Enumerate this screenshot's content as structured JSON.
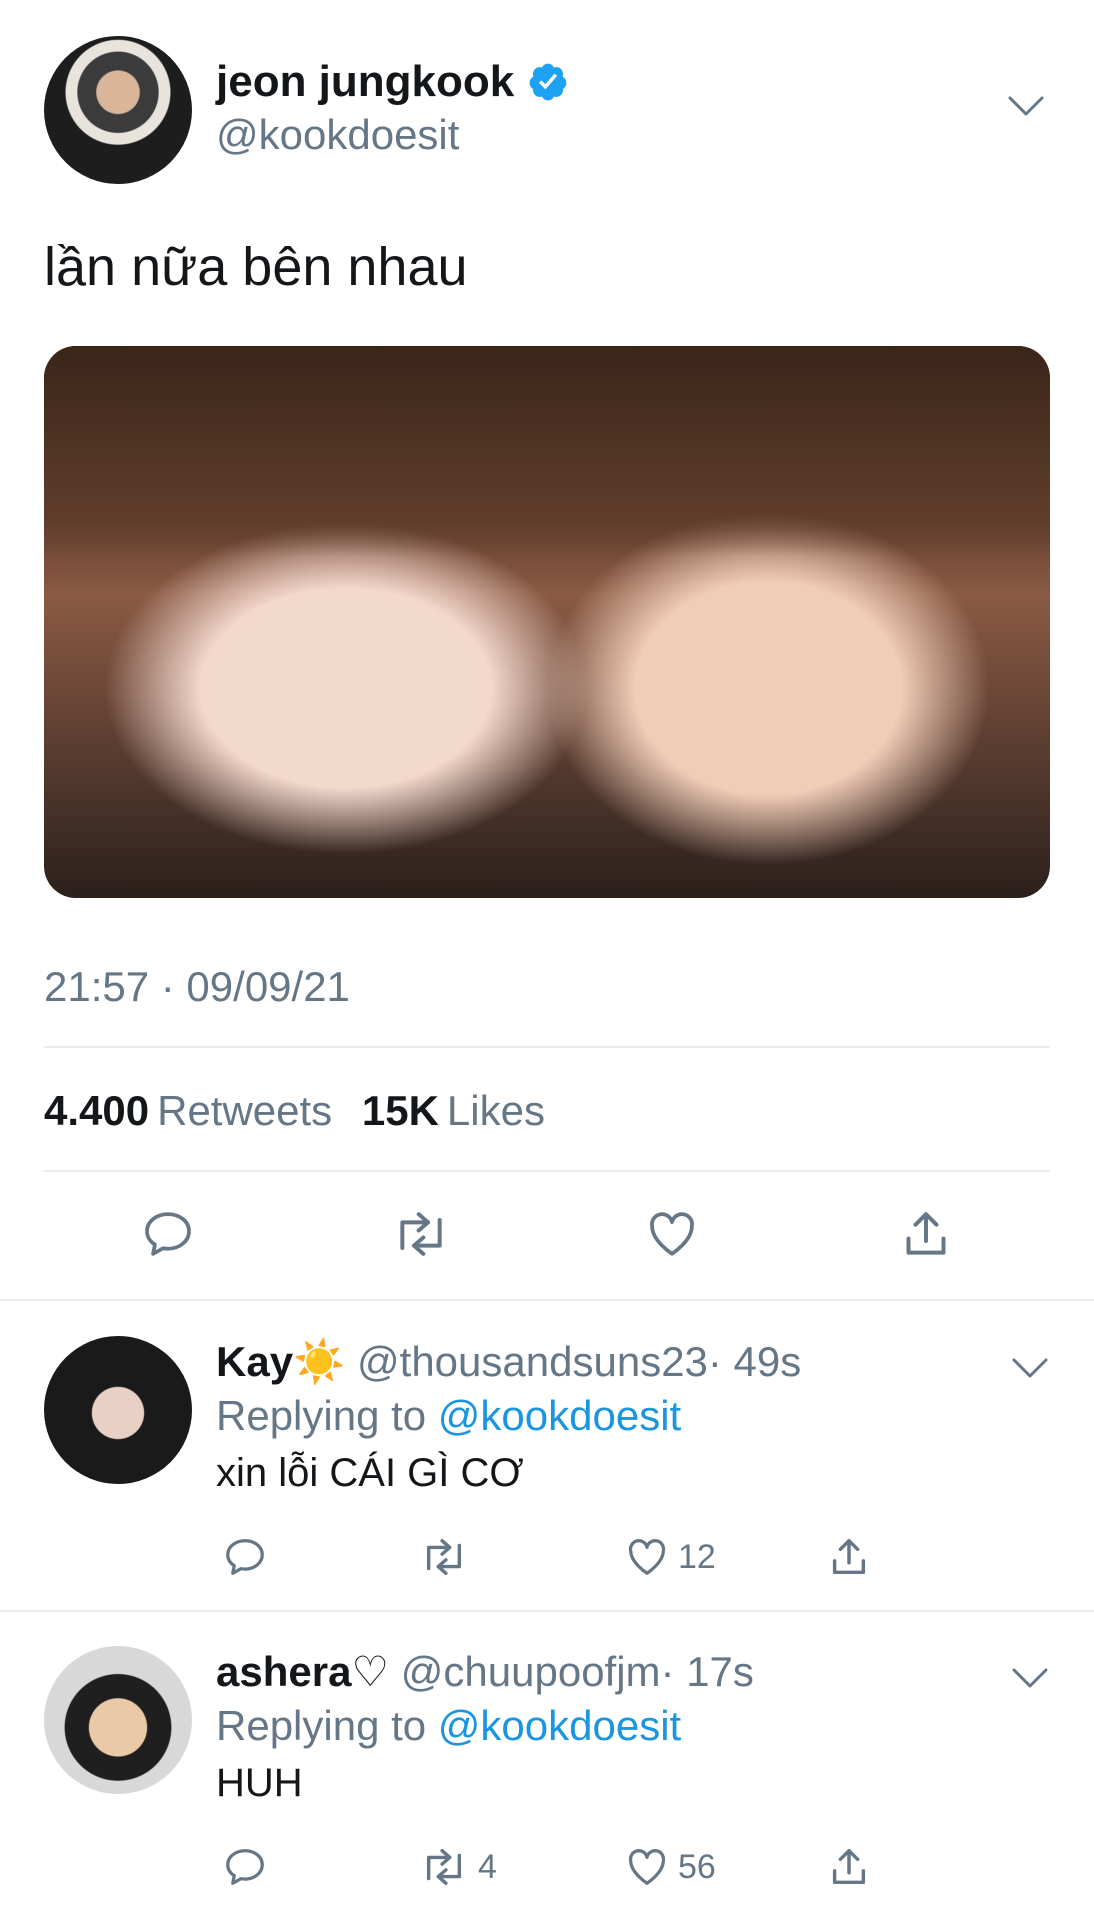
{
  "tweet": {
    "display_name": "jeon jungkook",
    "handle": "@kookdoesit",
    "text": "lần nữa bên nhau",
    "timestamp": "21:57 · 09/09/21",
    "retweets_count": "4.400",
    "retweets_label": "Retweets",
    "likes_count": "15K",
    "likes_label": "Likes"
  },
  "replies": [
    {
      "display_name": "Kay☀️",
      "handle": "@thousandsuns23",
      "time": "· 49s",
      "replying_prefix": "Replying to",
      "replying_to": "@kookdoesit",
      "text": "xin lỗi CÁI GÌ CƠ",
      "retweet_count": "",
      "like_count": "12"
    },
    {
      "display_name": "ashera♡",
      "handle": "@chuupoofjm",
      "time": "· 17s",
      "replying_prefix": "Replying to",
      "replying_to": "@kookdoesit",
      "text": "HUH",
      "retweet_count": "4",
      "like_count": "56"
    }
  ],
  "colors": {
    "verified": "#1da1f2",
    "link": "#1b95e0",
    "secondary_text": "#657786",
    "divider": "#e6ecf0",
    "icon": "#657786"
  },
  "icons": [
    "verified-badge-icon",
    "chevron-down-icon",
    "reply-icon",
    "retweet-icon",
    "like-icon",
    "share-icon"
  ]
}
